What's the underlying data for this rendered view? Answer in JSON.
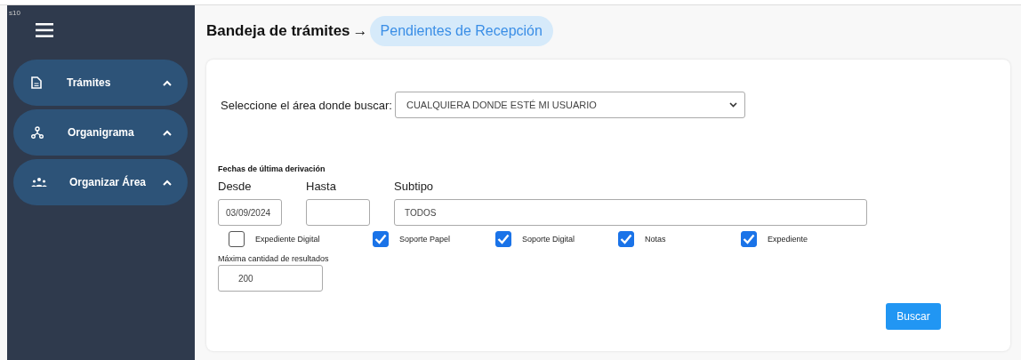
{
  "corner_text": "s10",
  "sidebar": {
    "items": [
      {
        "label": "Trámites",
        "kind": "document",
        "expanded": true
      },
      {
        "label": "Organigrama",
        "kind": "org",
        "expanded": true
      },
      {
        "label": "Organizar Área",
        "kind": "people",
        "expanded": true
      }
    ]
  },
  "breadcrumb": {
    "parent": "Bandeja de trámites",
    "separator": "→",
    "current": "Pendientes de Recepción"
  },
  "area_select": {
    "label": "Seleccione el área donde buscar:",
    "value": "CUALQUIERA DONDE ESTÉ MI USUARIO"
  },
  "dates": {
    "title": "Fechas de última derivación",
    "from": {
      "label": "Desde",
      "value": "03/09/2024"
    },
    "to": {
      "label": "Hasta"
    }
  },
  "subtipo": {
    "label": "Subtipo",
    "value": "TODOS"
  },
  "checkboxes": [
    {
      "label": "Expediente Digital",
      "checked": false
    },
    {
      "label": "Soporte Papel",
      "checked": true
    },
    {
      "label": "Soporte Digital",
      "checked": true
    },
    {
      "label": "Notas",
      "checked": true
    },
    {
      "label": "Expediente",
      "checked": true
    }
  ],
  "max_results": {
    "label": "Máxima cantidad de resultados",
    "value": "200"
  },
  "buttons": [
    "Buscar"
  ]
}
